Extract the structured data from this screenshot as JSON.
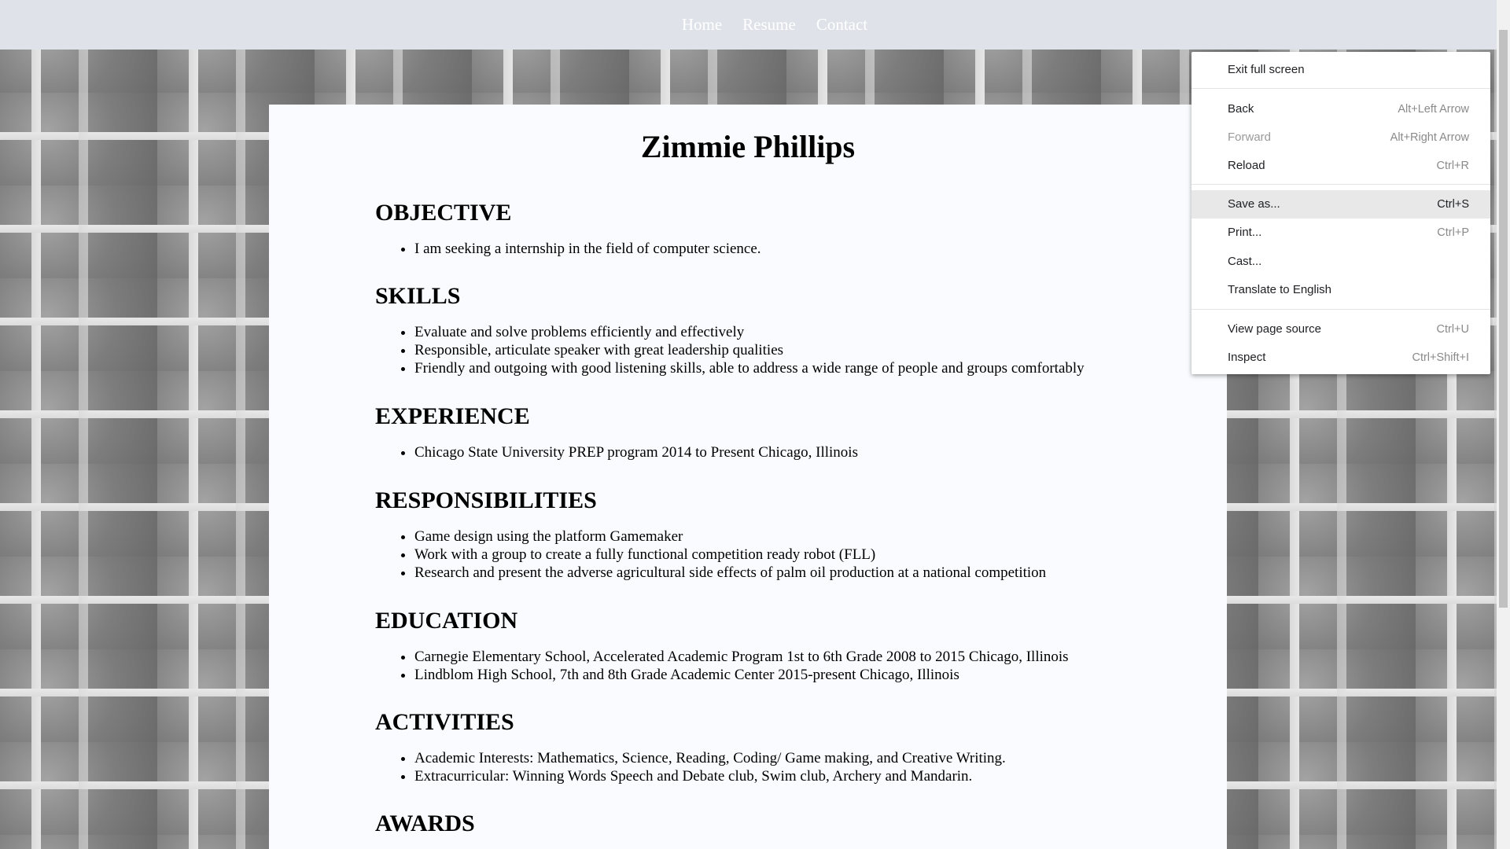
{
  "nav": {
    "items": [
      {
        "label": "Home"
      },
      {
        "label": "Resume"
      },
      {
        "label": "Contact"
      }
    ]
  },
  "resume": {
    "name": "Zimmie Phillips",
    "sections": [
      {
        "heading": "OBJECTIVE",
        "items": [
          "I am seeking a internship in the field of computer science."
        ]
      },
      {
        "heading": "SKILLS",
        "items": [
          "Evaluate and solve problems efficiently and effectively",
          "Responsible, articulate speaker with great leadership qualities",
          "Friendly and outgoing with good listening skills, able to address a wide range of people and groups comfortably"
        ]
      },
      {
        "heading": "EXPERIENCE",
        "items": [
          "Chicago State University PREP program 2014 to Present Chicago, Illinois"
        ]
      },
      {
        "heading": "RESPONSIBILITIES",
        "items": [
          "Game design using the platform Gamemaker",
          "Work with a group to create a fully functional competition ready robot (FLL)",
          "Research and present the adverse agricultural side effects of palm oil production at a national competition"
        ]
      },
      {
        "heading": "EDUCATION",
        "items": [
          "Carnegie Elementary School, Accelerated Academic Program 1st to 6th Grade 2008 to 2015 Chicago, Illinois",
          "Lindblom High School, 7th and 8th Grade Academic Center 2015-present Chicago, Illinois"
        ]
      },
      {
        "heading": "ACTIVITIES",
        "items": [
          "Academic Interests: Mathematics, Science, Reading, Coding/ Game making, and Creative Writing.",
          "Extracurricular: Winning Words Speech and Debate club, Swim club, Archery and Mandarin."
        ]
      },
      {
        "heading": "AWARDS",
        "items": []
      }
    ]
  },
  "context_menu": {
    "items": [
      {
        "label": "Exit full screen",
        "shortcut": ""
      },
      {
        "label": "Back",
        "shortcut": "Alt+Left Arrow"
      },
      {
        "label": "Forward",
        "shortcut": "Alt+Right Arrow",
        "disabled": true
      },
      {
        "label": "Reload",
        "shortcut": "Ctrl+R"
      },
      {
        "label": "Save as...",
        "shortcut": "Ctrl+S",
        "highlighted": true
      },
      {
        "label": "Print...",
        "shortcut": "Ctrl+P"
      },
      {
        "label": "Cast...",
        "shortcut": ""
      },
      {
        "label": "Translate to English",
        "shortcut": ""
      },
      {
        "label": "View page source",
        "shortcut": "Ctrl+U"
      },
      {
        "label": "Inspect",
        "shortcut": "Ctrl+Shift+I"
      }
    ]
  },
  "colors": {
    "nav_bg": "#dfe2e9",
    "page_bg": "#f9fbfe",
    "menu_highlight": "#e8e8e8"
  }
}
